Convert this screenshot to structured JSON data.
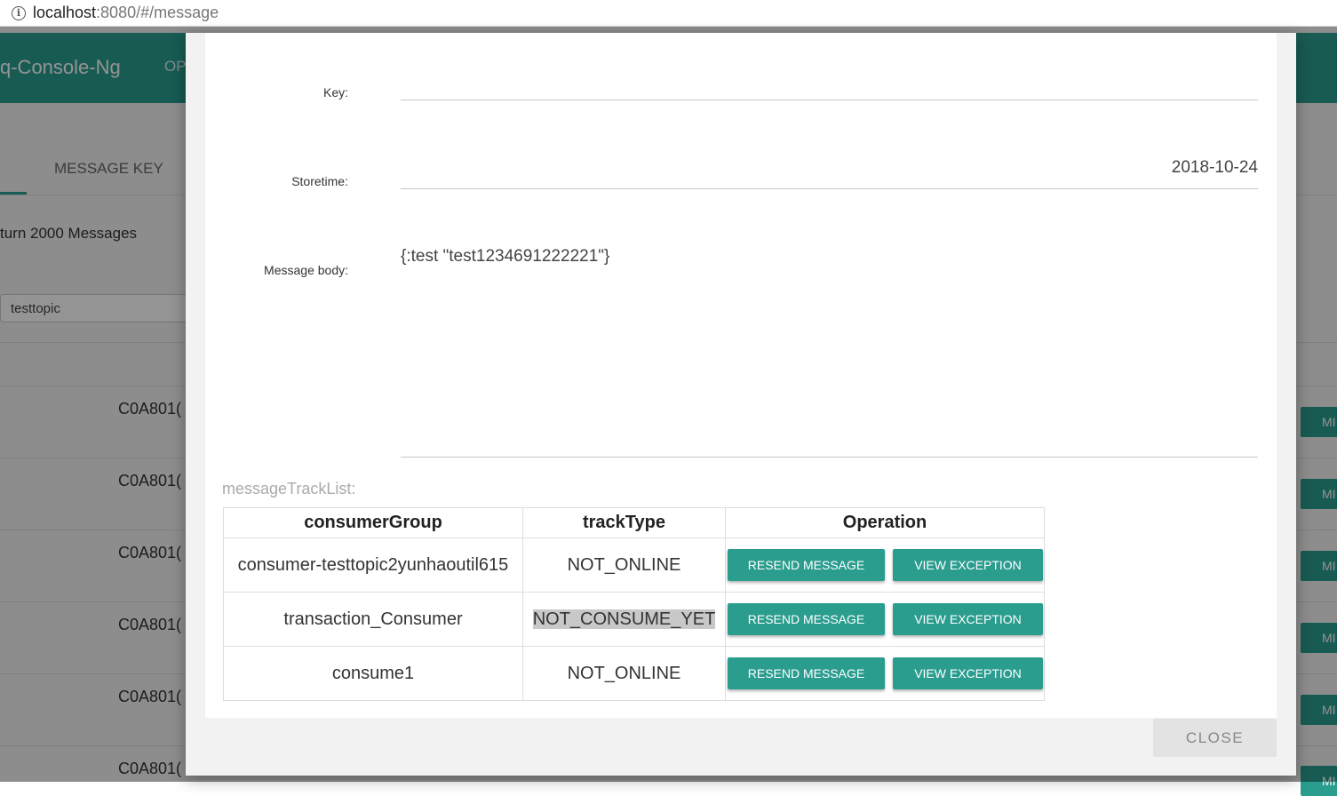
{
  "browser": {
    "url_host": "localhost",
    "url_rest": ":8080/#/message"
  },
  "app": {
    "brand": "q-Console-Ng",
    "nav_ops": "OP",
    "tab_message_key": "MESSAGE KEY",
    "return_text": "turn 2000 Messages",
    "topic_value": "testtopic",
    "row_ids": [
      "C0A801(",
      "C0A801(",
      "C0A801(",
      "C0A801(",
      "C0A801(",
      "C0A801("
    ],
    "row_button_label": "MI"
  },
  "modal": {
    "key_label": "Key:",
    "key_value": "",
    "storetime_label": "Storetime:",
    "storetime_value": "2018-10-24",
    "body_label": "Message body:",
    "body_value": "{:test \"test1234691222221\"}",
    "tracklist_label": "messageTrackList:",
    "table": {
      "headers": [
        "consumerGroup",
        "trackType",
        "Operation"
      ],
      "rows": [
        {
          "consumerGroup": "consumer-testtopic2yunhaoutil615",
          "trackType": "NOT_ONLINE"
        },
        {
          "consumerGroup": "transaction_Consumer",
          "trackType": "NOT_CONSUME_YET"
        },
        {
          "consumerGroup": "consume1",
          "trackType": "NOT_ONLINE"
        }
      ],
      "resend_label": "RESEND MESSAGE",
      "view_exception_label": "VIEW EXCEPTION"
    },
    "close_label": "CLOSE"
  },
  "colors": {
    "accent": "#2a9d8f",
    "overlay": "rgba(0,0,0,0.42)"
  }
}
